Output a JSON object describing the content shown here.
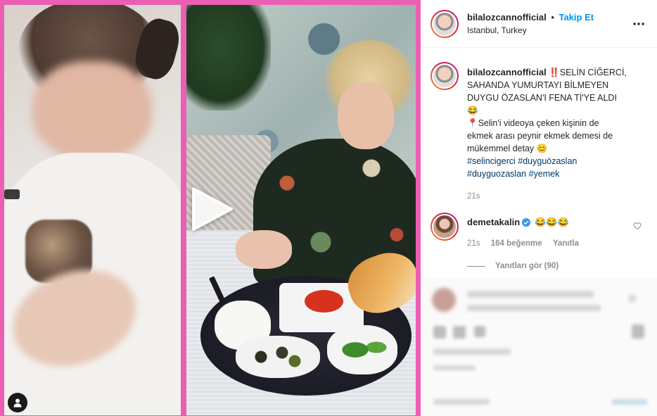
{
  "post": {
    "username": "bilalozcannofficial",
    "separator": "•",
    "follow_label": "Takip Et",
    "location": "Istanbul, Turkey",
    "more_icon": "more-horizontal-icon"
  },
  "media": {
    "play_icon": "play-icon",
    "user_tag_icon": "user-icon",
    "frame_color": "#ea5fb4"
  },
  "caption": {
    "username": "bilalozcannofficial",
    "lines": [
      "‼️SELİN CİĞERCİ,",
      "SAHANDA YUMURTAYI BİLMEYEN",
      "DUYGU ÖZASLAN'I FENA Tİ'YE ALDI",
      "😂",
      "📍Selin'i videoya çeken kişinin de",
      "ekmek arası peynir ekmek demesi de",
      "mükemmel detay 😊"
    ],
    "hashtags_line1": [
      "#selincigerci",
      "#duyguözaslan"
    ],
    "hashtags_line2": [
      "#duyguozaslan",
      "#yemek"
    ],
    "time": "21s"
  },
  "comment": {
    "username": "demetakalin",
    "text": "😂😂😂",
    "time": "21s",
    "likes": "164 beğenme",
    "reply_label": "Yanıtla",
    "view_replies": "Yanıtları gör (90)"
  },
  "colors": {
    "link_blue": "#0095f6",
    "hashtag": "#00376b",
    "muted": "#8e8e8e",
    "text": "#262626"
  }
}
